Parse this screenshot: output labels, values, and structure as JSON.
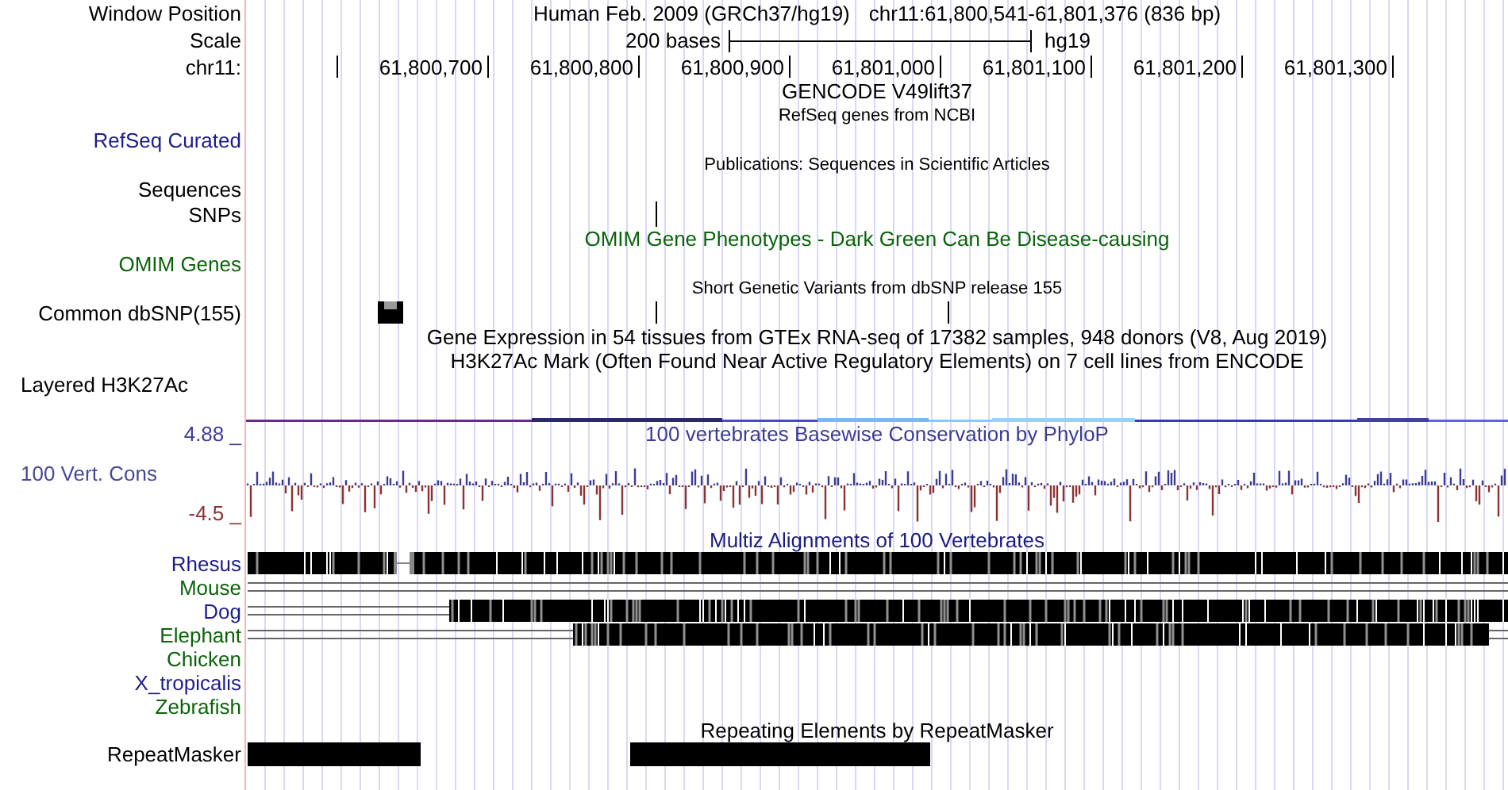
{
  "header": {
    "position_label": "Window Position",
    "assembly": "Human Feb. 2009 (GRCh37/hg19)",
    "range": "chr11:61,800,541-61,801,376 (836 bp)",
    "scale_label": "Scale",
    "scale_text": "200 bases",
    "scale_db": "hg19",
    "chrom_label": "chr11:",
    "ruler_ticks": [
      "61,800,700",
      "61,800,800",
      "61,800,900",
      "61,801,000",
      "61,801,100",
      "61,801,200",
      "61,801,300"
    ]
  },
  "rows": [
    {
      "kind": "title",
      "text": "GENCODE V49lift37",
      "color": "#000000"
    },
    {
      "kind": "note",
      "text": "RefSeq genes from NCBI"
    },
    {
      "kind": "label",
      "text": "RefSeq Curated",
      "color": "#1c1c8c"
    },
    {
      "kind": "note",
      "text": "Publications: Sequences in Scientific Articles"
    },
    {
      "kind": "label",
      "text": "Sequences",
      "color": "#000000"
    },
    {
      "kind": "snps",
      "text": "SNPs",
      "color": "#000000"
    },
    {
      "kind": "title",
      "text": "OMIM Gene Phenotypes - Dark Green Can Be Disease-causing",
      "color": "#0a640a"
    },
    {
      "kind": "label",
      "text": "OMIM Genes",
      "color": "#0a640a"
    },
    {
      "kind": "note",
      "text": "Short Genetic Variants from dbSNP release 155"
    },
    {
      "kind": "common_snps",
      "text": "Common dbSNP(155)",
      "color": "#000000"
    },
    {
      "kind": "title",
      "text": "Gene Expression in 54 tissues from GTEx RNA-seq of 17382 samples, 948 donors (V8, Aug 2019)",
      "color": "#000000"
    },
    {
      "kind": "title",
      "text": "H3K27Ac Mark (Often Found Near Active Regulatory Elements) on 7 cell lines from ENCODE",
      "color": "#000000"
    },
    {
      "kind": "layered",
      "text": "Layered H3K27Ac",
      "color": "#000000"
    }
  ],
  "conservation": {
    "title": "100 vertebrates Basewise Conservation by PhyloP",
    "max": "4.88 _",
    "label": "100 Vert. Cons",
    "min": "-4.5 _"
  },
  "multiz": {
    "title": "Multiz Alignments of 100 Vertebrates",
    "species": [
      {
        "label": "Rhesus",
        "color": "#1c1c8c",
        "kind": "gapped"
      },
      {
        "label": "Mouse",
        "color": "#0a640a",
        "kind": "unaligned"
      },
      {
        "label": "Dog",
        "color": "#1c1c8c",
        "kind": "partial"
      },
      {
        "label": "Elephant",
        "color": "#0a640a",
        "kind": "partial"
      },
      {
        "label": "Chicken",
        "color": "#0a640a",
        "kind": "none"
      },
      {
        "label": "X_tropicalis",
        "color": "#1c1c8c",
        "kind": "none"
      },
      {
        "label": "Zebrafish",
        "color": "#0a640a",
        "kind": "none"
      }
    ]
  },
  "repeats": {
    "title": "Repeating Elements by RepeatMasker",
    "label": "RepeatMasker"
  }
}
